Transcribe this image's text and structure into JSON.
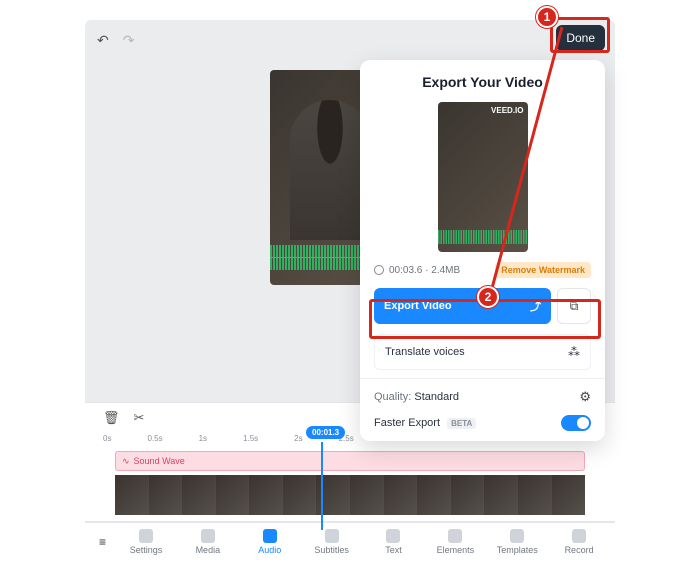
{
  "topbar": {
    "done_label": "Done"
  },
  "export": {
    "title": "Export Your Video",
    "watermark": "VEED.IO",
    "meta": "00:03.6 · 2.4MB",
    "remove_watermark": "Remove Watermark",
    "export_video_label": "Export Video",
    "translate_label": "Translate voices",
    "quality_label": "Quality:",
    "quality_value": "Standard",
    "faster_label": "Faster Export",
    "beta": "BETA"
  },
  "timeline": {
    "playhead": "00:01.3",
    "ticks": [
      "0s",
      "0.5s",
      "1s",
      "1.5s",
      "2s",
      "2.5s"
    ],
    "track_label": "Sound Wave"
  },
  "tabs": {
    "settings": "Settings",
    "media": "Media",
    "audio": "Audio",
    "subtitles": "Subtitles",
    "text": "Text",
    "elements": "Elements",
    "templates": "Templates",
    "record": "Record"
  },
  "annotations": {
    "one": "1",
    "two": "2"
  }
}
